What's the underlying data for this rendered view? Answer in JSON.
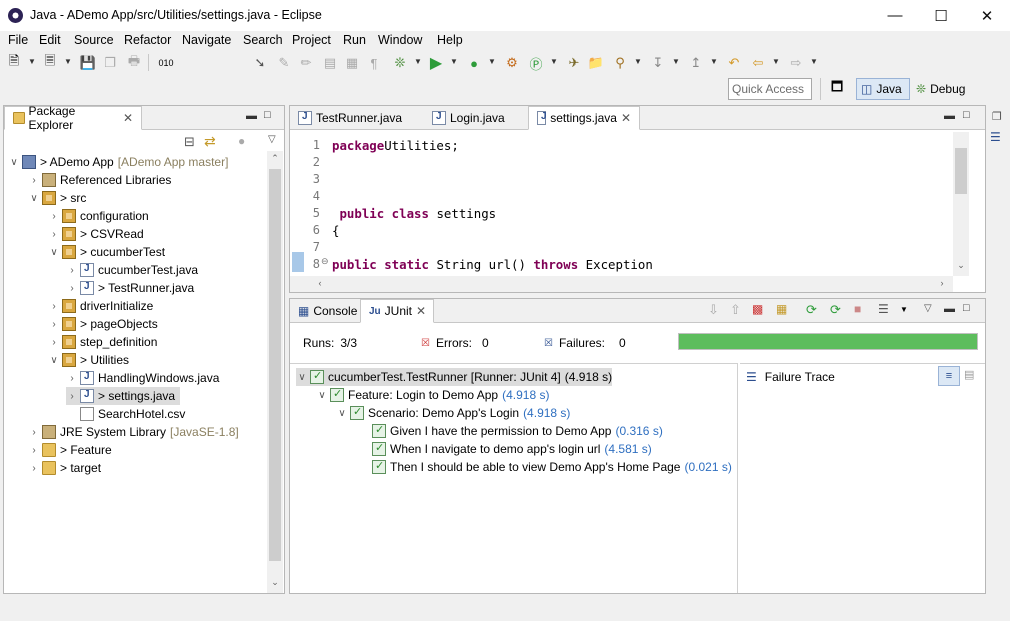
{
  "window": {
    "title": "Java - ADemo App/src/Utilities/settings.java - Eclipse"
  },
  "menu": [
    "File",
    "Edit",
    "Source",
    "Refactor",
    "Navigate",
    "Search",
    "Project",
    "Run",
    "Window",
    "Help"
  ],
  "quick_access": {
    "placeholder": "Quick Access"
  },
  "perspectives": {
    "java": "Java",
    "debug": "Debug"
  },
  "package_explorer": {
    "tab_label": "Package Explorer",
    "tree": [
      {
        "label": "> ADemo App",
        "suffix": "[ADemo App master]"
      },
      {
        "label": "Referenced Libraries"
      },
      {
        "label": "> src"
      },
      {
        "label": "configuration"
      },
      {
        "label": "> CSVRead"
      },
      {
        "label": "> cucumberTest"
      },
      {
        "label": "cucumberTest.java"
      },
      {
        "label": "> TestRunner.java"
      },
      {
        "label": "driverInitialize"
      },
      {
        "label": "> pageObjects"
      },
      {
        "label": "step_definition"
      },
      {
        "label": "> Utilities"
      },
      {
        "label": "HandlingWindows.java"
      },
      {
        "label": "> settings.java"
      },
      {
        "label": "SearchHotel.csv"
      },
      {
        "label": "JRE System Library",
        "suffix": "[JavaSE-1.8]"
      },
      {
        "label": "> Feature"
      },
      {
        "label": "> target"
      }
    ]
  },
  "editor": {
    "tabs": [
      "TestRunner.java",
      "Login.java",
      "settings.java"
    ],
    "lines": [
      {
        "n": "1",
        "parts": [
          [
            "kw",
            "package"
          ],
          [
            "",
            "Utilities;"
          ]
        ]
      },
      {
        "n": "2",
        "parts": []
      },
      {
        "n": "3",
        "parts": []
      },
      {
        "n": "4",
        "parts": []
      },
      {
        "n": "5",
        "parts": [
          [
            "kw",
            " public class"
          ],
          [
            "",
            " settings"
          ]
        ]
      },
      {
        "n": "6",
        "parts": [
          [
            "",
            "{"
          ]
        ]
      },
      {
        "n": "7",
        "parts": []
      },
      {
        "n": "8",
        "parts": [
          [
            "kw",
            "public static"
          ],
          [
            "",
            " String url() "
          ],
          [
            "kw",
            "throws"
          ],
          [
            "",
            " Exception"
          ]
        ]
      }
    ]
  },
  "bottom_tabs": {
    "console": "Console",
    "junit": "JUnit"
  },
  "junit": {
    "runs_label": "Runs:",
    "runs_value": "3/3",
    "errors_label": "Errors:",
    "errors_value": "0",
    "failures_label": "Failures:",
    "failures_value": "0",
    "progress": 1.0,
    "failure_trace_label": "Failure Trace",
    "results": [
      {
        "label": "cucumberTest.TestRunner [Runner: JUnit 4]",
        "time": "(4.918 s)"
      },
      {
        "label": "Feature: Login to Demo App",
        "time": "(4.918 s)"
      },
      {
        "label": "Scenario: Demo App's Login",
        "time": "(4.918 s)"
      },
      {
        "label": "Given I have the permission to Demo App",
        "time": "(0.316 s)"
      },
      {
        "label": "When I navigate to demo app's login url",
        "time": "(4.581 s)"
      },
      {
        "label": "Then I should be able to view Demo App's Home Page",
        "time": "(0.021 s)"
      }
    ]
  },
  "colors": {
    "success_bar": "#5dbd5d",
    "keyword": "#7f0055",
    "time": "#2f6fc0"
  }
}
